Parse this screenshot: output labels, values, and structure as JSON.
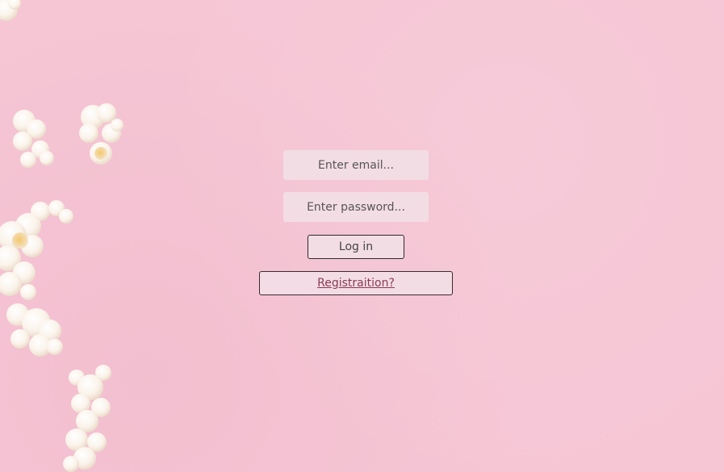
{
  "login": {
    "email_placeholder": "Enter email...",
    "password_placeholder": "Enter password...",
    "login_label": "Log in",
    "register_label": "Registraition?"
  },
  "colors": {
    "background": "#f6c6d5",
    "field_bg": "#f2e1e8",
    "button_border": "#2b2b2b",
    "link_text": "#8a3a55"
  },
  "icons": [
    "popcorn-decoration"
  ]
}
